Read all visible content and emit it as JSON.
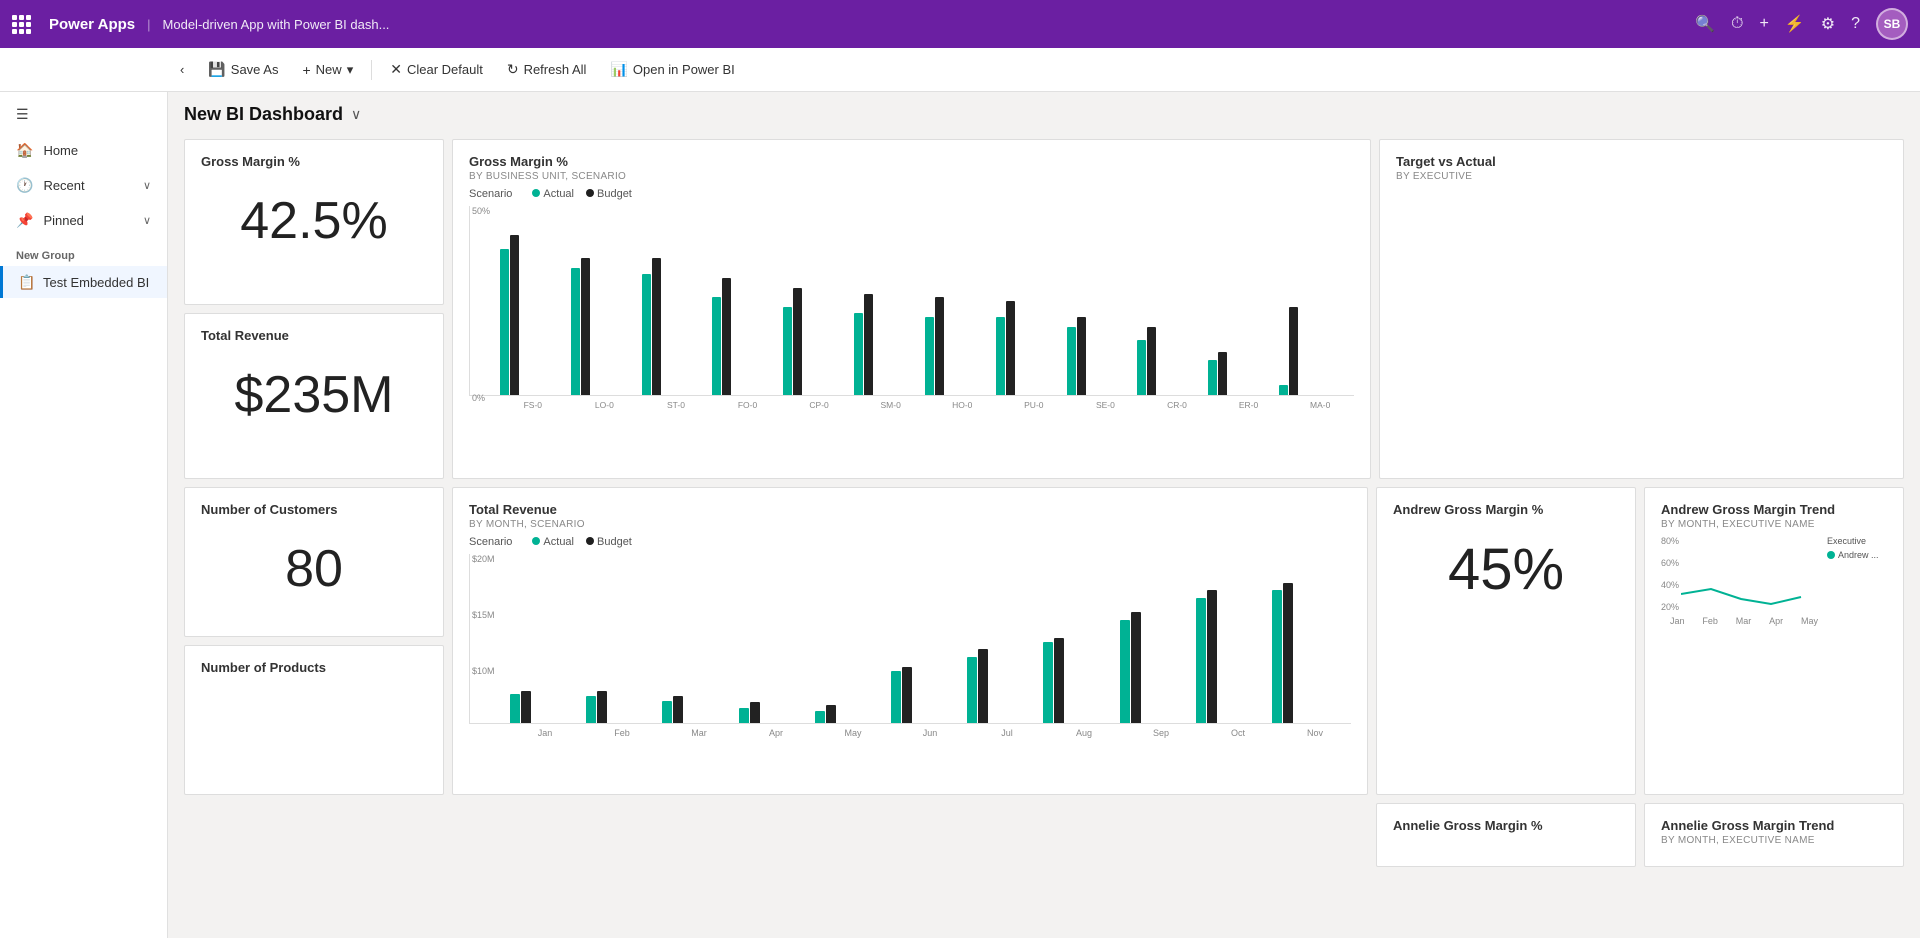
{
  "app": {
    "name": "Power Apps",
    "breadcrumb": "Model-driven App with Power BI dash..."
  },
  "topnav": {
    "search_icon": "🔍",
    "refresh_icon": "↻",
    "add_icon": "+",
    "filter_icon": "⚡",
    "settings_icon": "⚙",
    "help_icon": "?",
    "avatar_initials": "SB"
  },
  "toolbar": {
    "save_as": "Save As",
    "new": "New",
    "clear_default": "Clear Default",
    "refresh_all": "Refresh All",
    "open_in_power_bi": "Open in Power BI"
  },
  "sidebar": {
    "collapse_icon": "☰",
    "home": "Home",
    "recent": "Recent",
    "pinned": "Pinned",
    "group_label": "New Group",
    "nav_item": "Test Embedded BI"
  },
  "page": {
    "title": "New BI Dashboard"
  },
  "cards": {
    "gross_margin_pct": {
      "title": "Gross Margin %",
      "value": "42.5%"
    },
    "total_revenue": {
      "title": "Total Revenue",
      "value": "$235M"
    },
    "gross_margin_chart": {
      "title": "Gross Margin %",
      "subtitle": "BY BUSINESS UNIT, SCENARIO",
      "scenario_label": "Scenario",
      "legend_actual": "Actual",
      "legend_budget": "Budget",
      "y_50": "50%",
      "y_0": "0%",
      "labels": [
        "FS-0",
        "LO-0",
        "ST-0",
        "FO-0",
        "CP-0",
        "SM-0",
        "HO-0",
        "PU-0",
        "SE-0",
        "CR-0",
        "ER-0",
        "MA-0"
      ],
      "actual_heights": [
        75,
        65,
        62,
        50,
        45,
        42,
        40,
        40,
        35,
        28,
        18,
        5
      ],
      "budget_heights": [
        82,
        70,
        70,
        60,
        55,
        52,
        50,
        48,
        40,
        35,
        22,
        45
      ]
    },
    "target_vs_actual": {
      "title": "Target vs Actual",
      "subtitle": "BY EXECUTIVE"
    },
    "num_customers": {
      "title": "Number of Customers",
      "value": "80"
    },
    "total_revenue_chart": {
      "title": "Total Revenue",
      "subtitle": "BY MONTH, SCENARIO",
      "scenario_label": "Scenario",
      "legend_actual": "Actual",
      "legend_budget": "Budget",
      "y_20m": "$20M",
      "y_15m": "$15M",
      "y_10m": "$10M",
      "labels": [
        "Jan",
        "Feb",
        "Mar",
        "Apr",
        "May",
        "Jun",
        "Jul",
        "Aug",
        "Sep",
        "Oct",
        "Nov"
      ],
      "actual_heights": [
        20,
        18,
        15,
        10,
        8,
        35,
        45,
        55,
        70,
        85,
        90
      ],
      "budget_heights": [
        22,
        22,
        18,
        14,
        12,
        38,
        50,
        58,
        75,
        90,
        95
      ]
    },
    "andrew_gross_margin": {
      "title": "Andrew Gross Margin %",
      "value": "45%"
    },
    "andrew_trend": {
      "title": "Andrew Gross Margin Trend",
      "subtitle": "BY MONTH, EXECUTIVE NAME",
      "executive_label": "Executive",
      "legend_andrew": "Andrew ...",
      "y_80": "80%",
      "y_60": "60%",
      "y_40": "40%",
      "y_20": "20%",
      "x_labels": [
        "Jan",
        "Feb",
        "Mar",
        "Apr",
        "May"
      ]
    },
    "num_products": {
      "title": "Number of Products"
    },
    "annelie_gross_margin": {
      "title": "Annelie Gross Margin %"
    },
    "annelie_trend": {
      "title": "Annelie Gross Margin Trend",
      "subtitle": "BY MONTH, EXECUTIVE NAME"
    }
  }
}
